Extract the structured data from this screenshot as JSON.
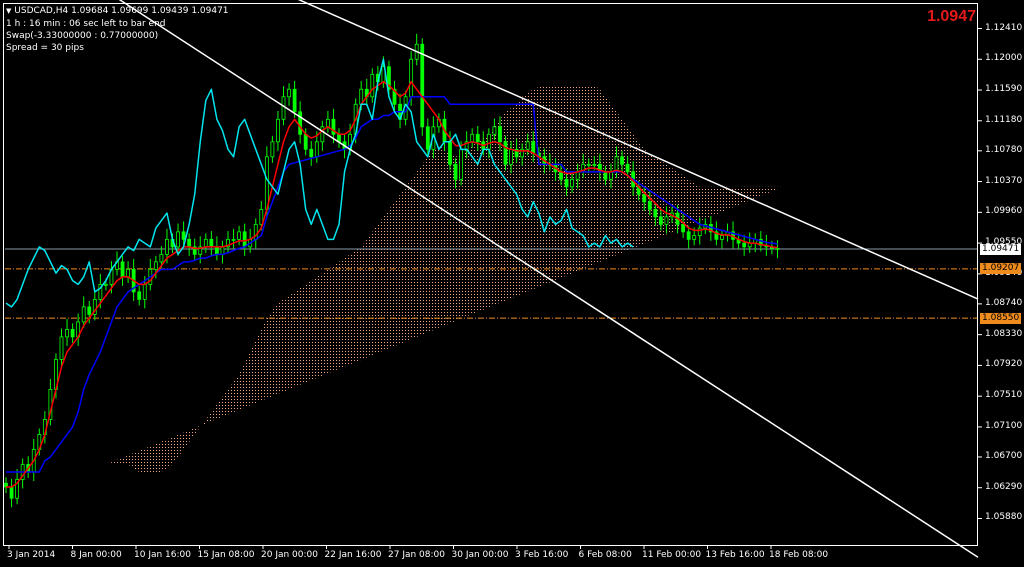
{
  "header": {
    "symbol_line": "USDCAD,H4  1.09684 1.09699 1.09439 1.09471",
    "timer_line": "1 h : 16 min : 06 sec left to bar end",
    "swap_line": "Swap(-3.33000000 : 0.77000000)",
    "spread_line": "Spread = 30 pips",
    "bid_big": "1.0947"
  },
  "price_labels": {
    "current": "1.09471",
    "level1": "1.09207",
    "level2": "1.08550"
  },
  "colors": {
    "background": "#000000",
    "candles": "#00ff00",
    "tenkan": "#ff0000",
    "kijun": "#0000ff",
    "chikou": "#00e5ee",
    "kumo": "#f4a582",
    "channel": "#ffffff",
    "levels": "#f08c1e",
    "bid_text": "#e41a1a"
  },
  "chart_data": {
    "type": "line",
    "symbol": "USDCAD",
    "timeframe": "H4",
    "ylim": [
      1.0558,
      1.1263
    ],
    "y_ticks": [
      "1.12410",
      "1.12000",
      "1.11590",
      "1.11180",
      "1.10780",
      "1.10370",
      "1.09960",
      "1.09550",
      "1.09140",
      "1.08740",
      "1.08330",
      "1.07920",
      "1.07510",
      "1.07100",
      "1.06700",
      "1.06290",
      "1.05880"
    ],
    "x_ticks": [
      "3 Jan 2014",
      "8 Jan 00:00",
      "10 Jan 16:00",
      "15 Jan 08:00",
      "20 Jan 00:00",
      "22 Jan 16:00",
      "27 Jan 08:00",
      "30 Jan 00:00",
      "3 Feb 16:00",
      "6 Feb 08:00",
      "11 Feb 00:00",
      "13 Feb 16:00",
      "18 Feb 08:00"
    ],
    "bars_shown": 140,
    "series": [
      {
        "key": "close",
        "values": [
          1.063,
          1.0615,
          1.064,
          1.066,
          1.065,
          1.068,
          1.07,
          1.072,
          1.076,
          1.08,
          1.083,
          1.084,
          1.083,
          1.085,
          1.087,
          1.086,
          1.088,
          1.09,
          1.09,
          1.092,
          1.093,
          1.091,
          1.092,
          1.089,
          1.088,
          1.09,
          1.092,
          1.093,
          1.094,
          1.096,
          1.095,
          1.097,
          1.096,
          1.095,
          1.094,
          1.095,
          1.096,
          1.095,
          1.094,
          1.095,
          1.096,
          1.096,
          1.097,
          1.095,
          1.096,
          1.098,
          1.1,
          1.107,
          1.109,
          1.112,
          1.115,
          1.116,
          1.113,
          1.11,
          1.108,
          1.107,
          1.109,
          1.111,
          1.112,
          1.11,
          1.109,
          1.108,
          1.11,
          1.114,
          1.116,
          1.115,
          1.118,
          1.117,
          1.119,
          1.116,
          1.114,
          1.112,
          1.115,
          1.12,
          1.122,
          1.111,
          1.108,
          1.111,
          1.112,
          1.109,
          1.106,
          1.104,
          1.108,
          1.109,
          1.11,
          1.109,
          1.108,
          1.11,
          1.111,
          1.109,
          1.106,
          1.108,
          1.107,
          1.108,
          1.109,
          1.1075,
          1.107,
          1.106,
          1.106,
          1.105,
          1.104,
          1.103,
          1.104,
          1.105,
          1.106,
          1.106,
          1.106,
          1.105,
          1.104,
          1.105,
          1.107,
          1.106,
          1.105,
          1.103,
          1.102,
          1.101,
          1.1,
          1.099,
          1.098,
          1.099,
          1.0995,
          1.098,
          1.097,
          1.096,
          1.0965,
          1.0975,
          1.098,
          1.097,
          1.096,
          1.0965,
          1.097,
          1.096,
          1.0955,
          1.095,
          1.0955,
          1.096,
          1.0952,
          1.095,
          1.0948,
          1.0947
        ]
      },
      {
        "key": "tenkan",
        "values": [
          1.063,
          1.063,
          1.0635,
          1.0645,
          1.0655,
          1.0665,
          1.068,
          1.07,
          1.073,
          1.076,
          1.079,
          1.081,
          1.082,
          1.083,
          1.0845,
          1.0855,
          1.0865,
          1.0875,
          1.0885,
          1.0895,
          1.0905,
          1.091,
          1.091,
          1.0905,
          1.09,
          1.09,
          1.0905,
          1.0915,
          1.0925,
          1.0935,
          1.094,
          1.0945,
          1.095,
          1.095,
          1.0948,
          1.0948,
          1.095,
          1.095,
          1.095,
          1.095,
          1.0952,
          1.0955,
          1.0958,
          1.0958,
          1.096,
          1.0965,
          1.0975,
          1.1,
          1.103,
          1.106,
          1.109,
          1.111,
          1.112,
          1.111,
          1.11,
          1.1095,
          1.1098,
          1.1105,
          1.111,
          1.1105,
          1.11,
          1.11,
          1.1105,
          1.112,
          1.114,
          1.115,
          1.116,
          1.1165,
          1.117,
          1.1165,
          1.1158,
          1.115,
          1.1155,
          1.117,
          1.116,
          1.115,
          1.114,
          1.113,
          1.112,
          1.1105,
          1.1095,
          1.1085,
          1.1085,
          1.1088,
          1.109,
          1.1088,
          1.1085,
          1.1088,
          1.109,
          1.1088,
          1.1082,
          1.108,
          1.1078,
          1.1078,
          1.1078,
          1.1075,
          1.107,
          1.1065,
          1.106,
          1.1055,
          1.105,
          1.1048,
          1.1048,
          1.105,
          1.1052,
          1.1055,
          1.1055,
          1.1052,
          1.105,
          1.105,
          1.1052,
          1.105,
          1.1045,
          1.1038,
          1.103,
          1.1022,
          1.1015,
          1.1008,
          1.1,
          1.0995,
          1.0992,
          1.0988,
          1.0982,
          1.0975,
          1.0972,
          1.0972,
          1.0974,
          1.0972,
          1.0968,
          1.0966,
          1.0966,
          1.0964,
          1.096,
          1.0957,
          1.0955,
          1.0955,
          1.0953,
          1.0952,
          1.095,
          1.0949
        ]
      },
      {
        "key": "kijun",
        "values": [
          1.065,
          1.065,
          1.065,
          1.065,
          1.065,
          1.065,
          1.065,
          1.0665,
          1.067,
          1.068,
          1.069,
          1.07,
          1.071,
          1.073,
          1.076,
          1.078,
          1.0795,
          1.081,
          1.083,
          1.085,
          1.087,
          1.088,
          1.089,
          1.0895,
          1.09,
          1.0905,
          1.091,
          1.0915,
          1.092,
          1.092,
          1.092,
          1.0925,
          1.093,
          1.093,
          1.0932,
          1.0935,
          1.0935,
          1.0938,
          1.094,
          1.094,
          1.0942,
          1.0945,
          1.0948,
          1.095,
          1.0955,
          1.096,
          1.0965,
          1.099,
          1.101,
          1.103,
          1.105,
          1.106,
          1.1062,
          1.1064,
          1.1066,
          1.1068,
          1.107,
          1.1072,
          1.1074,
          1.1076,
          1.1078,
          1.108,
          1.1085,
          1.1095,
          1.111,
          1.1115,
          1.112,
          1.112,
          1.1125,
          1.1125,
          1.113,
          1.113,
          1.113,
          1.115,
          1.115,
          1.115,
          1.115,
          1.115,
          1.115,
          1.115,
          1.114,
          1.114,
          1.114,
          1.114,
          1.114,
          1.114,
          1.114,
          1.114,
          1.114,
          1.114,
          1.114,
          1.114,
          1.114,
          1.114,
          1.114,
          1.114,
          1.106,
          1.106,
          1.106,
          1.106,
          1.106,
          1.105,
          1.105,
          1.105,
          1.105,
          1.105,
          1.105,
          1.105,
          1.105,
          1.105,
          1.105,
          1.105,
          1.1045,
          1.104,
          1.1035,
          1.103,
          1.1025,
          1.102,
          1.1015,
          1.101,
          1.1005,
          1.1,
          1.0995,
          1.099,
          1.0985,
          1.098,
          1.0978,
          1.0976,
          1.0974,
          1.0972,
          1.097,
          1.0968,
          1.0966,
          1.0964,
          1.0962,
          1.096,
          1.0958,
          1.0956,
          1.0955,
          1.0954
        ]
      },
      {
        "key": "chikou",
        "values": [
          1.0875,
          1.087,
          1.088,
          1.09,
          1.092,
          1.0935,
          1.095,
          1.0945,
          1.093,
          1.0915,
          1.0925,
          1.092,
          1.0905,
          1.09,
          1.091,
          1.093,
          1.089,
          1.0895,
          1.0905,
          1.092,
          1.093,
          1.094,
          1.095,
          1.0945,
          1.096,
          1.0955,
          1.095,
          1.0975,
          1.0985,
          1.0995,
          1.096,
          1.094,
          1.095,
          1.098,
          1.102,
          1.109,
          1.1145,
          1.116,
          1.112,
          1.1105,
          1.108,
          1.107,
          1.111,
          1.112,
          1.11,
          1.108,
          1.106,
          1.104,
          1.103,
          1.102,
          1.105,
          1.108,
          1.109,
          1.106,
          1.1,
          1.098,
          1.1,
          1.098,
          1.096,
          1.096,
          1.098,
          1.105,
          1.108,
          1.11,
          1.114,
          1.114,
          1.112,
          1.117,
          1.12,
          1.115,
          1.113,
          1.112,
          1.114,
          1.113,
          1.109,
          1.108,
          1.107,
          1.11,
          1.108,
          1.109,
          1.109,
          1.11,
          1.108,
          1.108,
          1.107,
          1.106,
          1.108,
          1.108,
          1.106,
          1.105,
          1.104,
          1.103,
          1.102,
          1.1,
          1.099,
          1.101,
          1.0995,
          1.097,
          1.099,
          1.098,
          1.0985,
          1.1,
          1.0975,
          1.097,
          1.0965,
          1.095,
          1.0955,
          1.095,
          1.0965,
          1.0955,
          1.096,
          1.095,
          1.0955,
          1.095
        ]
      },
      {
        "key": "span_a",
        "values": [
          1.0655,
          1.0655,
          1.0655,
          1.066,
          1.066,
          1.0655,
          1.065,
          1.065,
          1.065,
          1.065,
          1.065,
          1.0655,
          1.066,
          1.067,
          1.068,
          1.069,
          1.07,
          1.071,
          1.072,
          1.073,
          1.074,
          1.075,
          1.076,
          1.077,
          1.078,
          1.0795,
          1.081,
          1.0825,
          1.084,
          1.0855,
          1.0865,
          1.0875,
          1.088,
          1.0885,
          1.089,
          1.0895,
          1.09,
          1.0905,
          1.091,
          1.0915,
          1.092,
          1.0925,
          1.093,
          1.0935,
          1.094,
          1.0945,
          1.095,
          1.096,
          1.097,
          1.098,
          1.099,
          1.1,
          1.101,
          1.102,
          1.103,
          1.104,
          1.105,
          1.106,
          1.107,
          1.108,
          1.1085,
          1.108,
          1.1075,
          1.107,
          1.1075,
          1.108,
          1.1085,
          1.109,
          1.1095,
          1.11,
          1.111,
          1.112,
          1.113,
          1.1135,
          1.114,
          1.1145,
          1.115,
          1.115,
          1.115,
          1.115,
          1.1145,
          1.114,
          1.113,
          1.112,
          1.111,
          1.11,
          1.1095,
          1.109,
          1.1085,
          1.108,
          1.1075,
          1.107,
          1.107,
          1.107,
          1.1065,
          1.106,
          1.105,
          1.1045,
          1.104,
          1.1035,
          1.103,
          1.1025,
          1.102,
          1.1015,
          1.101,
          1.1005,
          1.1,
          1.0995,
          1.099,
          1.0985,
          1.098,
          1.0978,
          1.0976,
          1.0974,
          1.0972,
          1.097,
          1.0975,
          1.0975,
          1.0975,
          1.0975,
          1.0975,
          1.0975,
          1.0975,
          1.0975,
          1.0975
        ]
      },
      {
        "key": "span_b",
        "values": [
          1.066,
          1.066,
          1.066,
          1.065,
          1.0648,
          1.0648,
          1.0648,
          1.0648,
          1.0648,
          1.0648,
          1.0648,
          1.0648,
          1.0648,
          1.0648,
          1.0648,
          1.0648,
          1.0648,
          1.0648,
          1.0648,
          1.0648,
          1.0648,
          1.0648,
          1.0648,
          1.0648,
          1.0648,
          1.0648,
          1.0648,
          1.0648,
          1.0648,
          1.0648,
          1.0648,
          1.068,
          1.07,
          1.072,
          1.0735,
          1.075,
          1.076,
          1.077,
          1.078,
          1.079,
          1.08,
          1.081,
          1.082,
          1.083,
          1.084,
          1.085,
          1.086,
          1.087,
          1.088,
          1.089,
          1.09,
          1.091,
          1.092,
          1.093,
          1.094,
          1.095,
          1.096,
          1.097,
          1.098,
          1.099,
          1.1,
          1.101,
          1.102,
          1.103,
          1.104,
          1.105,
          1.106,
          1.107,
          1.108,
          1.109,
          1.11,
          1.111,
          1.112,
          1.113,
          1.114,
          1.115,
          1.1155,
          1.116,
          1.1163,
          1.1165,
          1.1165,
          1.1165,
          1.1165,
          1.1165,
          1.1165,
          1.1165,
          1.1165,
          1.1165,
          1.1165,
          1.116,
          1.115,
          1.114,
          1.113,
          1.112,
          1.111,
          1.11,
          1.109,
          1.108,
          1.1075,
          1.107,
          1.1065,
          1.106,
          1.1055,
          1.105,
          1.1045,
          1.104,
          1.1035,
          1.103,
          1.103,
          1.103,
          1.103,
          1.103,
          1.103,
          1.103,
          1.103,
          1.103,
          1.103,
          1.103,
          1.103,
          1.103,
          1.103,
          1.103,
          1.103
        ]
      }
    ],
    "channel": {
      "upper": [
        {
          "bar": 71,
          "price": 1.122
        },
        {
          "bar": 140,
          "price": 1.0995
        }
      ],
      "lower": [
        {
          "bar": 37,
          "price": 1.12
        },
        {
          "bar": 88,
          "price": 1.0955
        }
      ],
      "extends_right": true
    },
    "levels": [
      {
        "price": 1.09207,
        "style": "dashdot"
      },
      {
        "price": 1.0855,
        "style": "dashdot"
      },
      {
        "price": 1.09471,
        "style": "solid",
        "kind": "bid"
      }
    ]
  }
}
